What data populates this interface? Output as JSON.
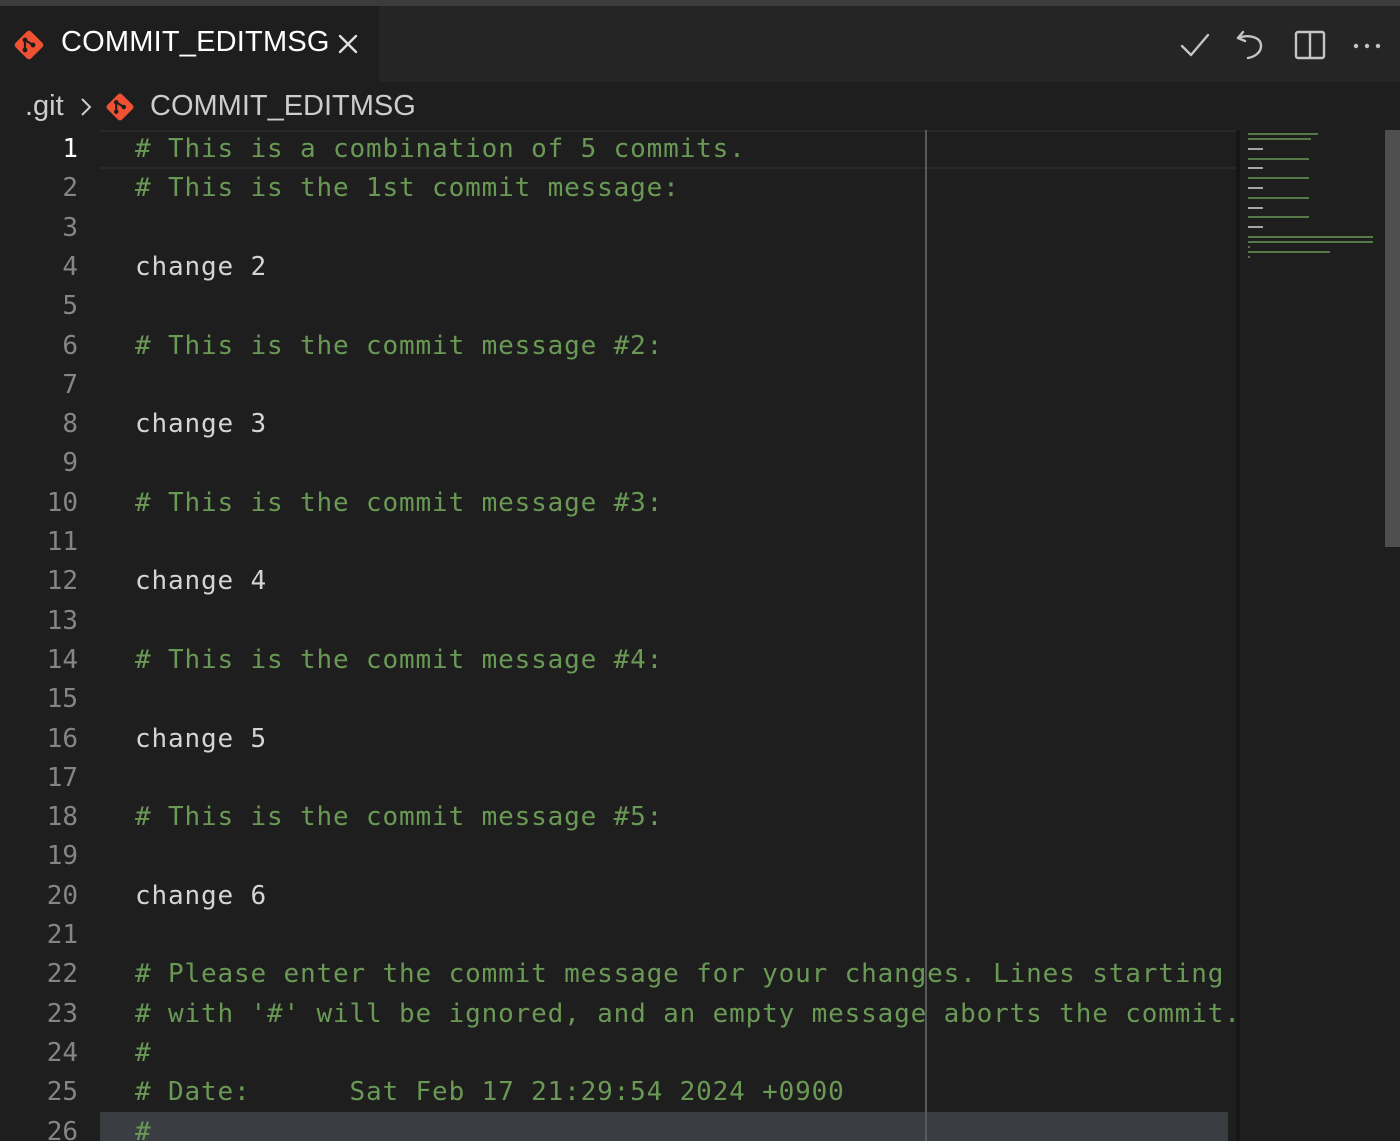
{
  "tab": {
    "title": "COMMIT_EDITMSG"
  },
  "breadcrumb": {
    "folder": ".git",
    "file": "COMMIT_EDITMSG"
  },
  "colors": {
    "accent_git": "#f05133",
    "comment": "#6a9955",
    "text": "#d4d4d4"
  },
  "icons": {
    "tab": "git-file-icon",
    "close": "close-icon",
    "actions": [
      "checkmark-icon",
      "undo-icon",
      "split-editor-icon",
      "more-icon"
    ]
  },
  "editor": {
    "lines": [
      {
        "n": "1",
        "t": "# This is a combination of 5 commits.",
        "c": true
      },
      {
        "n": "2",
        "t": "# This is the 1st commit message:",
        "c": true
      },
      {
        "n": "3",
        "t": "",
        "c": false
      },
      {
        "n": "4",
        "t": "change 2",
        "c": false
      },
      {
        "n": "5",
        "t": "",
        "c": false
      },
      {
        "n": "6",
        "t": "# This is the commit message #2:",
        "c": true
      },
      {
        "n": "7",
        "t": "",
        "c": false
      },
      {
        "n": "8",
        "t": "change 3",
        "c": false
      },
      {
        "n": "9",
        "t": "",
        "c": false
      },
      {
        "n": "10",
        "t": "# This is the commit message #3:",
        "c": true
      },
      {
        "n": "11",
        "t": "",
        "c": false
      },
      {
        "n": "12",
        "t": "change 4",
        "c": false
      },
      {
        "n": "13",
        "t": "",
        "c": false
      },
      {
        "n": "14",
        "t": "# This is the commit message #4:",
        "c": true
      },
      {
        "n": "15",
        "t": "",
        "c": false
      },
      {
        "n": "16",
        "t": "change 5",
        "c": false
      },
      {
        "n": "17",
        "t": "",
        "c": false
      },
      {
        "n": "18",
        "t": "# This is the commit message #5:",
        "c": true
      },
      {
        "n": "19",
        "t": "",
        "c": false
      },
      {
        "n": "20",
        "t": "change 6",
        "c": false
      },
      {
        "n": "21",
        "t": "",
        "c": false
      },
      {
        "n": "22",
        "t": "# Please enter the commit message for your changes. Lines starting",
        "c": true
      },
      {
        "n": "23",
        "t": "# with '#' will be ignored, and an empty message aborts the commit.",
        "c": true
      },
      {
        "n": "24",
        "t": "#",
        "c": true
      },
      {
        "n": "25",
        "t": "# Date:      Sat Feb 17 21:29:54 2024 +0900",
        "c": true
      },
      {
        "n": "26",
        "t": "#",
        "c": true
      }
    ]
  }
}
